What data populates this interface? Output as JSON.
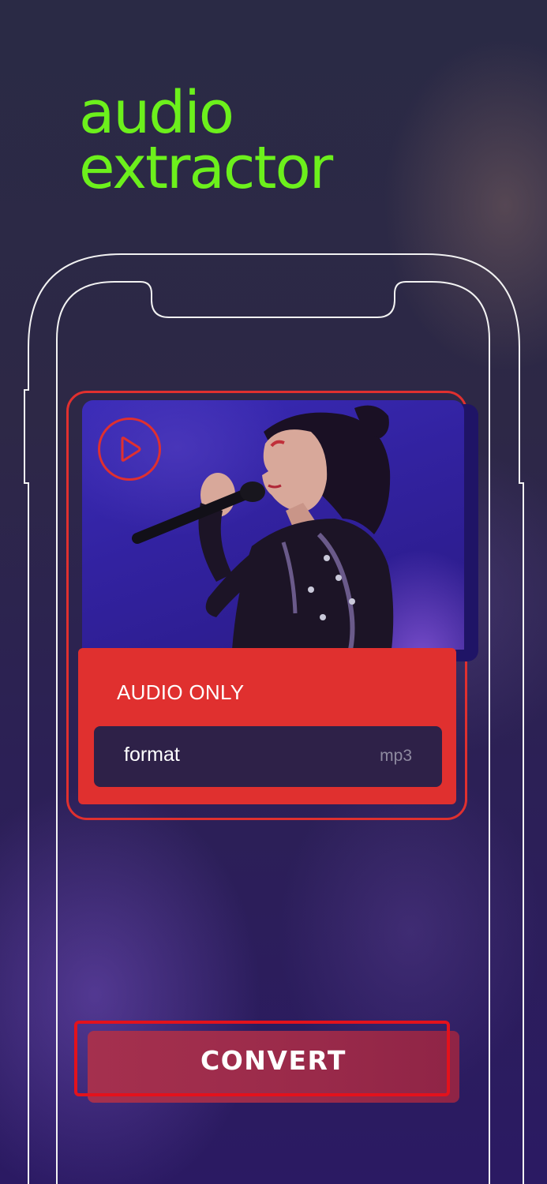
{
  "app": {
    "title_line1": "audio",
    "title_line2": "extractor"
  },
  "card": {
    "play_icon": "play-icon",
    "mode_label": "AUDIO ONLY",
    "format": {
      "label": "format",
      "value": "mp3"
    }
  },
  "actions": {
    "convert_label": "CONVERT"
  },
  "colors": {
    "accent_green": "#6cf01c",
    "accent_red": "#e0302f",
    "convert_bg": "#9a2a4a",
    "format_row_bg": "#2e2148"
  }
}
